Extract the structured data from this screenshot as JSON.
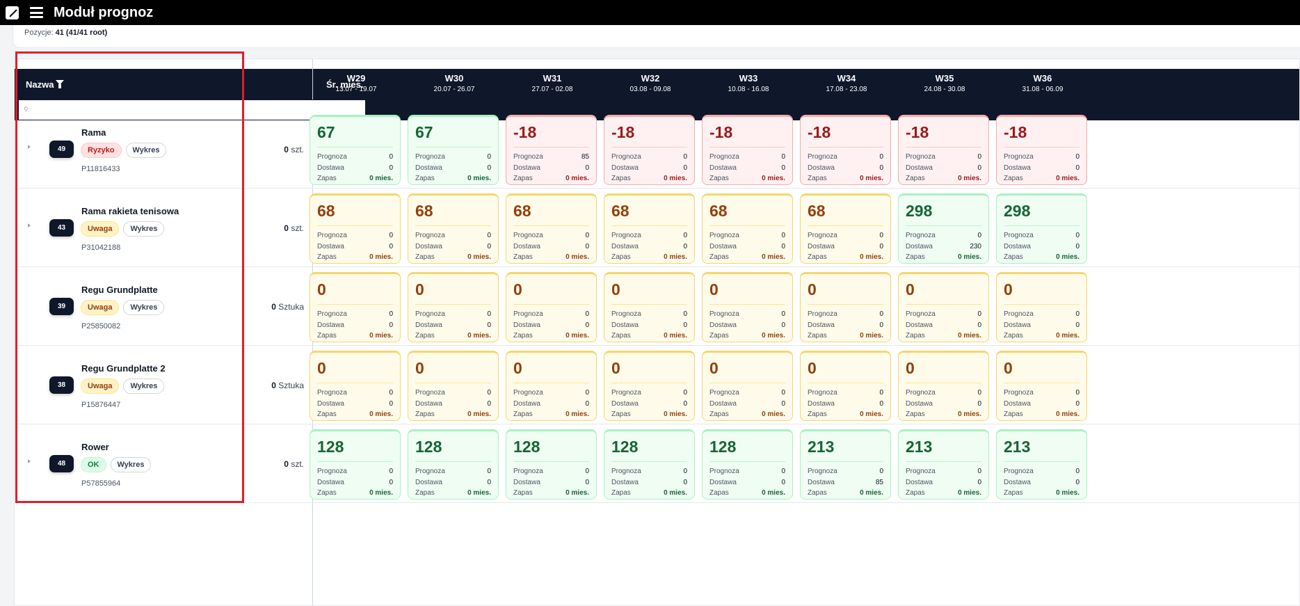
{
  "header": {
    "app_title": "Moduł prognoz"
  },
  "info": {
    "label": "Pozycje:",
    "value": "41 (41/41 root)"
  },
  "table": {
    "col_name": "Nazwa",
    "col_avg": "Śr. mies.",
    "filter_placeholder": "",
    "filter_icon": "⚲:",
    "weeks": [
      {
        "wk": "W29",
        "range": "13.07 - 19.07"
      },
      {
        "wk": "W30",
        "range": "20.07 - 26.07"
      },
      {
        "wk": "W31",
        "range": "27.07 - 02.08"
      },
      {
        "wk": "W32",
        "range": "03.08 - 09.08"
      },
      {
        "wk": "W33",
        "range": "10.08 - 16.08"
      },
      {
        "wk": "W34",
        "range": "17.08 - 23.08"
      },
      {
        "wk": "W35",
        "range": "24.08 - 30.08"
      },
      {
        "wk": "W36",
        "range": "31.08 - 06.09"
      }
    ],
    "labels": {
      "forecast": "Prognoza",
      "delivery": "Dostawa",
      "stock": "Zapas",
      "chart_btn": "Wykres"
    },
    "rows": [
      {
        "count": "49",
        "name": "Rama",
        "status": "Ryzyko",
        "status_kind": "risk",
        "sku": "P11816433",
        "has_children": true,
        "avg_value": "0",
        "avg_unit": "szt.",
        "cells": [
          {
            "v": "67",
            "kind": "green",
            "p": "0",
            "d": "0",
            "z": "0 mies."
          },
          {
            "v": "67",
            "kind": "green",
            "p": "0",
            "d": "0",
            "z": "0 mies."
          },
          {
            "v": "-18",
            "kind": "red",
            "p": "85",
            "d": "0",
            "z": "0 mies."
          },
          {
            "v": "-18",
            "kind": "red",
            "p": "0",
            "d": "0",
            "z": "0 mies."
          },
          {
            "v": "-18",
            "kind": "red",
            "p": "0",
            "d": "0",
            "z": "0 mies."
          },
          {
            "v": "-18",
            "kind": "red",
            "p": "0",
            "d": "0",
            "z": "0 mies."
          },
          {
            "v": "-18",
            "kind": "red",
            "p": "0",
            "d": "0",
            "z": "0 mies."
          },
          {
            "v": "-18",
            "kind": "red",
            "p": "0",
            "d": "0",
            "z": "0 mies."
          }
        ]
      },
      {
        "count": "43",
        "name": "Rama rakieta tenisowa",
        "status": "Uwaga",
        "status_kind": "warn",
        "sku": "P31042188",
        "has_children": true,
        "avg_value": "0",
        "avg_unit": "szt.",
        "cells": [
          {
            "v": "68",
            "kind": "yellow",
            "p": "0",
            "d": "0",
            "z": "0 mies."
          },
          {
            "v": "68",
            "kind": "yellow",
            "p": "0",
            "d": "0",
            "z": "0 mies."
          },
          {
            "v": "68",
            "kind": "yellow",
            "p": "0",
            "d": "0",
            "z": "0 mies."
          },
          {
            "v": "68",
            "kind": "yellow",
            "p": "0",
            "d": "0",
            "z": "0 mies."
          },
          {
            "v": "68",
            "kind": "yellow",
            "p": "0",
            "d": "0",
            "z": "0 mies."
          },
          {
            "v": "68",
            "kind": "yellow",
            "p": "0",
            "d": "0",
            "z": "0 mies."
          },
          {
            "v": "298",
            "kind": "green",
            "p": "0",
            "d": "230",
            "z": "0 mies."
          },
          {
            "v": "298",
            "kind": "green",
            "p": "0",
            "d": "0",
            "z": "0 mies."
          }
        ]
      },
      {
        "count": "39",
        "name": "Regu Grundplatte",
        "status": "Uwaga",
        "status_kind": "warn",
        "sku": "P25850082",
        "has_children": false,
        "avg_value": "0",
        "avg_unit": "Sztuka",
        "cells": [
          {
            "v": "0",
            "kind": "yellow",
            "p": "0",
            "d": "0",
            "z": "0 mies."
          },
          {
            "v": "0",
            "kind": "yellow",
            "p": "0",
            "d": "0",
            "z": "0 mies."
          },
          {
            "v": "0",
            "kind": "yellow",
            "p": "0",
            "d": "0",
            "z": "0 mies."
          },
          {
            "v": "0",
            "kind": "yellow",
            "p": "0",
            "d": "0",
            "z": "0 mies."
          },
          {
            "v": "0",
            "kind": "yellow",
            "p": "0",
            "d": "0",
            "z": "0 mies."
          },
          {
            "v": "0",
            "kind": "yellow",
            "p": "0",
            "d": "0",
            "z": "0 mies."
          },
          {
            "v": "0",
            "kind": "yellow",
            "p": "0",
            "d": "0",
            "z": "0 mies."
          },
          {
            "v": "0",
            "kind": "yellow",
            "p": "0",
            "d": "0",
            "z": "0 mies."
          }
        ]
      },
      {
        "count": "38",
        "name": "Regu Grundplatte 2",
        "status": "Uwaga",
        "status_kind": "warn",
        "sku": "P15876447",
        "has_children": false,
        "avg_value": "0",
        "avg_unit": "Sztuka",
        "cells": [
          {
            "v": "0",
            "kind": "yellow",
            "p": "0",
            "d": "0",
            "z": "0 mies."
          },
          {
            "v": "0",
            "kind": "yellow",
            "p": "0",
            "d": "0",
            "z": "0 mies."
          },
          {
            "v": "0",
            "kind": "yellow",
            "p": "0",
            "d": "0",
            "z": "0 mies."
          },
          {
            "v": "0",
            "kind": "yellow",
            "p": "0",
            "d": "0",
            "z": "0 mies."
          },
          {
            "v": "0",
            "kind": "yellow",
            "p": "0",
            "d": "0",
            "z": "0 mies."
          },
          {
            "v": "0",
            "kind": "yellow",
            "p": "0",
            "d": "0",
            "z": "0 mies."
          },
          {
            "v": "0",
            "kind": "yellow",
            "p": "0",
            "d": "0",
            "z": "0 mies."
          },
          {
            "v": "0",
            "kind": "yellow",
            "p": "0",
            "d": "0",
            "z": "0 mies."
          }
        ]
      },
      {
        "count": "48",
        "name": "Rower",
        "status": "OK",
        "status_kind": "ok",
        "sku": "P57855964",
        "has_children": true,
        "avg_value": "0",
        "avg_unit": "szt.",
        "cells": [
          {
            "v": "128",
            "kind": "green",
            "p": "0",
            "d": "0",
            "z": "0 mies."
          },
          {
            "v": "128",
            "kind": "green",
            "p": "0",
            "d": "0",
            "z": "0 mies."
          },
          {
            "v": "128",
            "kind": "green",
            "p": "0",
            "d": "0",
            "z": "0 mies."
          },
          {
            "v": "128",
            "kind": "green",
            "p": "0",
            "d": "0",
            "z": "0 mies."
          },
          {
            "v": "128",
            "kind": "green",
            "p": "0",
            "d": "0",
            "z": "0 mies."
          },
          {
            "v": "213",
            "kind": "green",
            "p": "0",
            "d": "85",
            "z": "0 mies."
          },
          {
            "v": "213",
            "kind": "green",
            "p": "0",
            "d": "0",
            "z": "0 mies."
          },
          {
            "v": "213",
            "kind": "green",
            "p": "0",
            "d": "0",
            "z": "0 mies."
          }
        ]
      }
    ]
  },
  "colors": {
    "header_bg": "#0f172a",
    "highlight": "#e11d2a",
    "ok": "#166534",
    "risk": "#991b1b",
    "warn": "#92400e"
  },
  "icons": {
    "logo": "app-logo-icon",
    "menu": "hamburger-icon",
    "filter": "funnel-icon",
    "expand": "caret-right-icon"
  }
}
